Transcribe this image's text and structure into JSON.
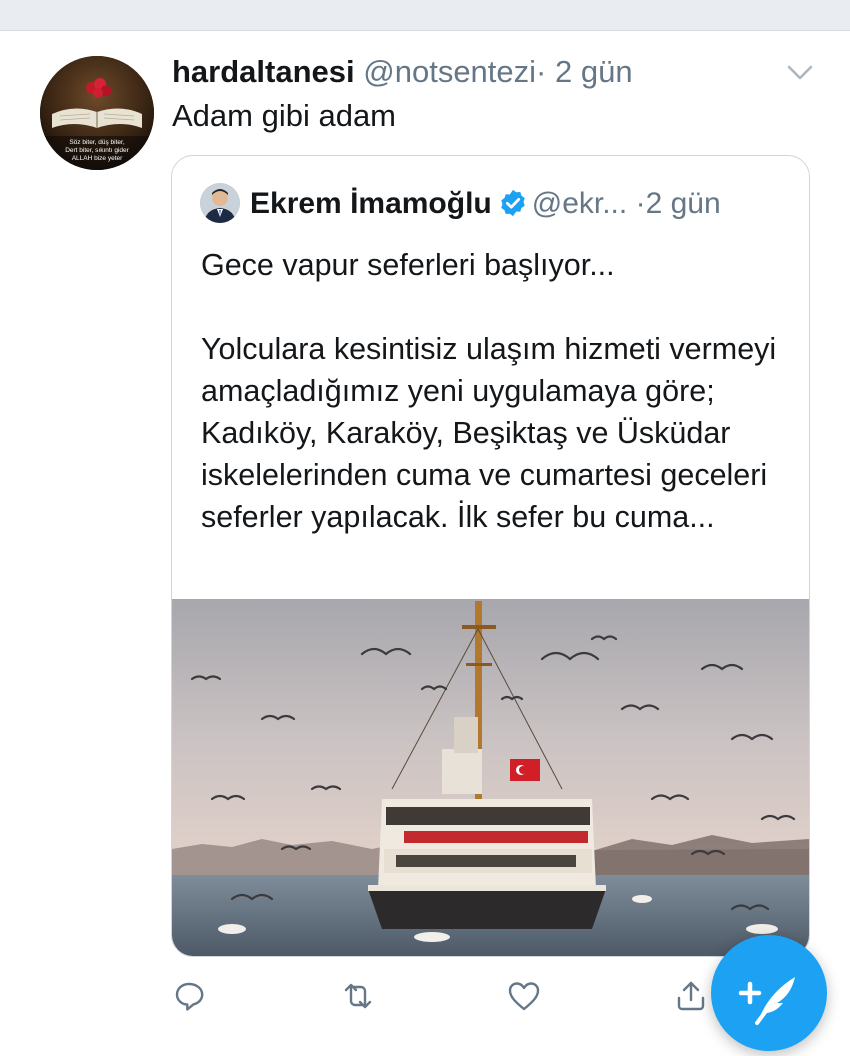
{
  "tweet": {
    "author_name": "hardaltanesi",
    "author_handle": "@notsentezi",
    "separator": "·",
    "time": "2 gün",
    "text": "Adam gibi adam",
    "avatar_caption_line1": "Söz biter, düş biter,",
    "avatar_caption_line2": "Dert biter, sıkıntı gider",
    "avatar_caption_line3": "ALLAH bize yeter"
  },
  "quoted_tweet": {
    "author_name": "Ekrem İmamoğlu",
    "author_handle": "@ekr...",
    "time": "·2 gün",
    "text": "Gece vapur seferleri başlıyor...\n\nYolculara kesintisiz ulaşım hizmeti vermeyi amaçladığımız yeni uygulamaya göre; Kadıköy, Karaköy, Beşiktaş ve Üsküdar iskelelerinden cuma ve cumartesi geceleri seferler yapılacak. İlk sefer bu cuma...",
    "verified_badge_icon": "verified-check-icon"
  },
  "actions": {
    "icons": [
      "reply-icon",
      "retweet-icon",
      "like-icon",
      "share-icon"
    ]
  },
  "compose_button": {
    "icon": "compose-feather-icon"
  },
  "colors": {
    "accent": "#1da1f2",
    "secondary_text": "#657786",
    "border": "#ccd6dd"
  }
}
